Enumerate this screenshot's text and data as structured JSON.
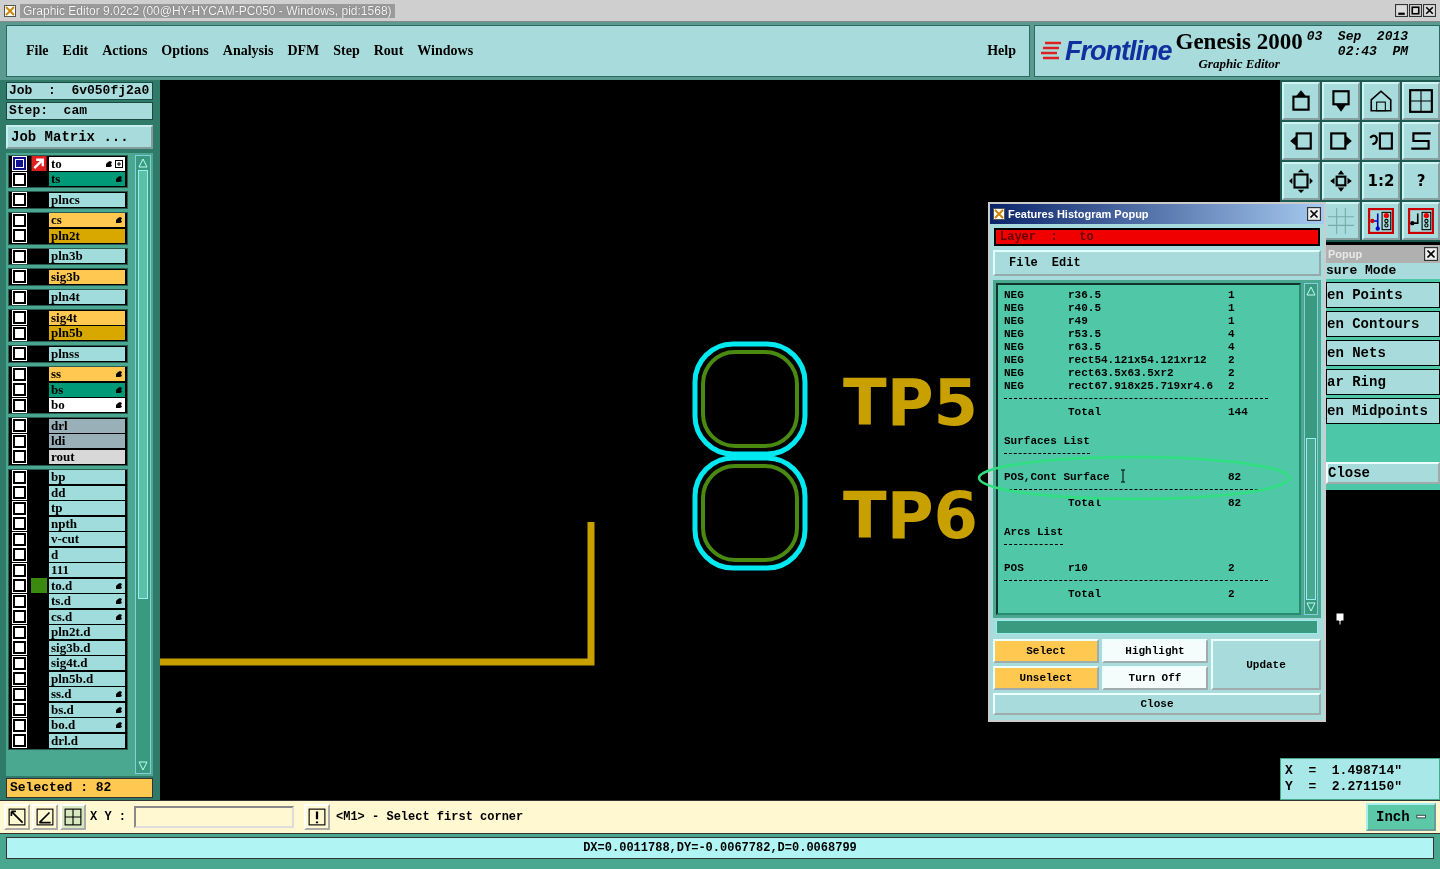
{
  "window": {
    "title": "Graphic Editor 9.02c2 (00@HY-HYCAM-PC050 - Windows, pid:1568)"
  },
  "menu": [
    "File",
    "Edit",
    "Actions",
    "Options",
    "Analysis",
    "DFM",
    "Step",
    "Rout",
    "Windows"
  ],
  "help": "Help",
  "brand": {
    "logo": "Frontline",
    "product": "Genesis 2000",
    "subtitle": "Graphic Editor",
    "date": "03  Sep  2013",
    "time": "02:43  PM"
  },
  "job": {
    "job": "Job  :  6v050fj2a0",
    "step": "Step:  cam",
    "matrix_button": "Job Matrix ..."
  },
  "layer_groups": [
    {
      "layers": [
        {
          "name": "to",
          "color": "#ffffff",
          "hand": true,
          "work": true,
          "marked": false
        },
        {
          "name": "ts",
          "color": "#009a78",
          "hand": true,
          "work": false,
          "marked": false
        }
      ]
    },
    {
      "layers": [
        {
          "name": "plncs",
          "color": "#a0dcdc",
          "hand": false,
          "work": false,
          "marked": false
        }
      ]
    },
    {
      "layers": [
        {
          "name": "cs",
          "color": "#ffc850",
          "hand": true,
          "work": false,
          "marked": false
        },
        {
          "name": "pln2t",
          "color": "#d8a800",
          "hand": false,
          "work": false,
          "marked": false
        }
      ]
    },
    {
      "layers": [
        {
          "name": "pln3b",
          "color": "#a0dcdc",
          "hand": false,
          "work": false,
          "marked": false
        }
      ]
    },
    {
      "layers": [
        {
          "name": "sig3b",
          "color": "#ffc850",
          "hand": false,
          "work": false,
          "marked": false
        }
      ]
    },
    {
      "layers": [
        {
          "name": "pln4t",
          "color": "#a0dcdc",
          "hand": false,
          "work": false,
          "marked": false
        }
      ]
    },
    {
      "layers": [
        {
          "name": "sig4t",
          "color": "#ffc850",
          "hand": false,
          "work": false,
          "marked": false
        },
        {
          "name": "pln5b",
          "color": "#d8a800",
          "hand": false,
          "work": false,
          "marked": false
        }
      ]
    },
    {
      "layers": [
        {
          "name": "plnss",
          "color": "#a0dcdc",
          "hand": false,
          "work": false,
          "marked": false
        }
      ]
    },
    {
      "layers": [
        {
          "name": "ss",
          "color": "#ffc850",
          "hand": true,
          "work": false,
          "marked": false
        },
        {
          "name": "bs",
          "color": "#009a78",
          "hand": true,
          "work": false,
          "marked": false
        },
        {
          "name": "bo",
          "color": "#ffffff",
          "hand": true,
          "work": false,
          "marked": false
        }
      ]
    },
    {
      "layers": [
        {
          "name": "drl",
          "color": "#9ab0b8",
          "hand": false,
          "work": false,
          "marked": false
        },
        {
          "name": "ldi",
          "color": "#9ab0b8",
          "hand": false,
          "work": false,
          "marked": false
        },
        {
          "name": "rout",
          "color": "#d8d8d8",
          "hand": false,
          "work": false,
          "marked": false
        }
      ]
    },
    {
      "layers": [
        {
          "name": "bp",
          "color": "#a0dcdc",
          "hand": false,
          "work": false,
          "marked": false
        },
        {
          "name": "dd",
          "color": "#a0dcdc",
          "hand": false,
          "work": false,
          "marked": false
        },
        {
          "name": "tp",
          "color": "#a0dcdc",
          "hand": false,
          "work": false,
          "marked": false
        },
        {
          "name": "npth",
          "color": "#a0dcdc",
          "hand": false,
          "work": false,
          "marked": false
        },
        {
          "name": "v-cut",
          "color": "#a0dcdc",
          "hand": false,
          "work": false,
          "marked": false
        },
        {
          "name": "d",
          "color": "#a0dcdc",
          "hand": false,
          "work": false,
          "marked": false
        },
        {
          "name": "111",
          "color": "#a0dcdc",
          "hand": false,
          "work": false,
          "marked": false
        },
        {
          "name": "to.d",
          "color": "#a0dcdc",
          "hand": true,
          "work": false,
          "marked": true
        },
        {
          "name": "ts.d",
          "color": "#a0dcdc",
          "hand": true,
          "work": false,
          "marked": false
        },
        {
          "name": "cs.d",
          "color": "#a0dcdc",
          "hand": true,
          "work": false,
          "marked": false
        },
        {
          "name": "pln2t.d",
          "color": "#a0dcdc",
          "hand": false,
          "work": false,
          "marked": false
        },
        {
          "name": "sig3b.d",
          "color": "#a0dcdc",
          "hand": false,
          "work": false,
          "marked": false
        },
        {
          "name": "sig4t.d",
          "color": "#a0dcdc",
          "hand": false,
          "work": false,
          "marked": false
        },
        {
          "name": "pln5b.d",
          "color": "#a0dcdc",
          "hand": false,
          "work": false,
          "marked": false
        },
        {
          "name": "ss.d",
          "color": "#a0dcdc",
          "hand": true,
          "work": false,
          "marked": false
        },
        {
          "name": "bs.d",
          "color": "#a0dcdc",
          "hand": true,
          "work": false,
          "marked": false
        },
        {
          "name": "bo.d",
          "color": "#a0dcdc",
          "hand": true,
          "work": false,
          "marked": false
        },
        {
          "name": "drl.d",
          "color": "#a0dcdc",
          "hand": false,
          "work": false,
          "marked": false
        }
      ]
    }
  ],
  "selected_count": "Selected : 82",
  "canvas": {
    "labels": [
      "TP5",
      "TP6"
    ]
  },
  "toolbar_labels": [
    "1:2",
    "?"
  ],
  "histogram": {
    "title": "Features Histogram Popup",
    "layer": "Layer  :   to",
    "menu": [
      "File",
      "Edit"
    ],
    "lines": [
      {
        "kind": "row",
        "type": "NEG",
        "symbol": "r36.5",
        "count": "1"
      },
      {
        "kind": "row",
        "type": "NEG",
        "symbol": "r40.5",
        "count": "1"
      },
      {
        "kind": "row",
        "type": "NEG",
        "symbol": "r49",
        "count": "1"
      },
      {
        "kind": "row",
        "type": "NEG",
        "symbol": "r53.5",
        "count": "4"
      },
      {
        "kind": "row",
        "type": "NEG",
        "symbol": "r63.5",
        "count": "4"
      },
      {
        "kind": "row",
        "type": "NEG",
        "symbol": "rect54.121x54.121xr12",
        "count": "2"
      },
      {
        "kind": "row",
        "type": "NEG",
        "symbol": "rect63.5x63.5xr2",
        "count": "2"
      },
      {
        "kind": "row",
        "type": "NEG",
        "symbol": "rect67.918x25.719xr4.6",
        "count": "2"
      },
      {
        "kind": "rule"
      },
      {
        "kind": "row",
        "symbol": "Total",
        "count": "144"
      },
      {
        "kind": "blank"
      },
      {
        "kind": "heading",
        "text": "Surfaces List"
      },
      {
        "kind": "blank"
      },
      {
        "kind": "row",
        "type": "POS,Cont Surface",
        "count": "82"
      },
      {
        "kind": "rule"
      },
      {
        "kind": "row",
        "symbol": "Total",
        "count": "82"
      },
      {
        "kind": "blank"
      },
      {
        "kind": "heading",
        "text": "Arcs List"
      },
      {
        "kind": "blank"
      },
      {
        "kind": "row",
        "type": "POS",
        "symbol": "r10",
        "count": "2"
      },
      {
        "kind": "rule"
      },
      {
        "kind": "row",
        "symbol": "Total",
        "count": "2"
      }
    ],
    "buttons": [
      {
        "label": "Select",
        "kind": "small",
        "color": "#ffc850"
      },
      {
        "label": "Highlight",
        "kind": "small",
        "color": "#f4fcfc"
      },
      {
        "label": "Update",
        "kind": "tall",
        "color": "#a8dcdc"
      },
      {
        "label": "Unselect",
        "kind": "small",
        "color": "#ffc850"
      },
      {
        "label": "Turn Off",
        "kind": "small",
        "color": "#f4fcfc"
      },
      {
        "label": "Close",
        "kind": "wide",
        "color": "#a8dcdc"
      }
    ]
  },
  "measure_popup": {
    "title": "Popup",
    "header": "sure Mode",
    "items": [
      "en Points",
      "en Contours",
      "en Nets",
      "ar Ring",
      "en Midpoints"
    ],
    "close": "Close"
  },
  "coordinates": [
    "X  =  1.498714\"",
    "Y  =  2.271150\""
  ],
  "command_bar": {
    "xy_label": "X Y :",
    "prompt": "<M1> - Select first corner",
    "units": "Inch"
  },
  "status": "DX=0.0011788,DY=-0.0067782,D=0.0068799"
}
